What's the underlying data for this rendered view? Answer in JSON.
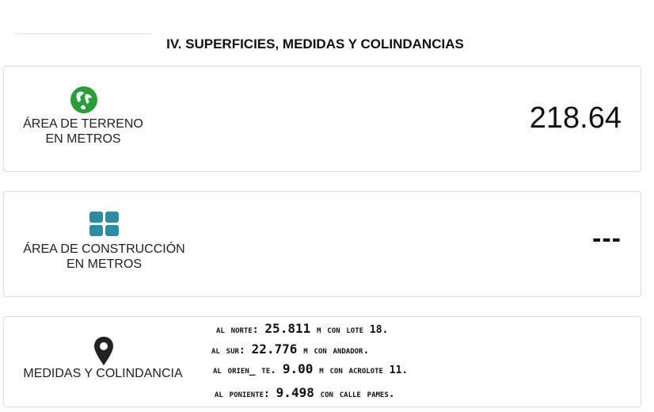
{
  "section": {
    "title": "IV. SUPERFICIES, MEDIDAS Y COLINDANCIAS"
  },
  "land_area": {
    "icon": "globe-icon",
    "label_line1": "ÁREA DE TERRENO",
    "label_line2": "EN METROS",
    "value": "218.64"
  },
  "construction_area": {
    "icon": "grid-icon",
    "label_line1": "ÁREA DE CONSTRUCCIÓN",
    "label_line2": "EN METROS",
    "value": "---"
  },
  "boundaries": {
    "icon": "map-pin-icon",
    "label": "MEDIDAS Y COLINDANCIA",
    "lines": [
      {
        "prefix": "al norte: ",
        "number": "25.811",
        "suffix": " m con lote 18."
      },
      {
        "prefix": "al sur: ",
        "number": "22.776",
        "suffix": " m con andador."
      },
      {
        "prefix": "al orien_ te. ",
        "number": "9.00",
        "suffix": " m con acrolote 11."
      },
      {
        "prefix": "al poniente: ",
        "number": "9.498",
        "suffix": " con calle pames."
      }
    ]
  },
  "colors": {
    "globe": "#2a9c3a",
    "grid": "#2f8aa5",
    "pin": "#222222"
  }
}
